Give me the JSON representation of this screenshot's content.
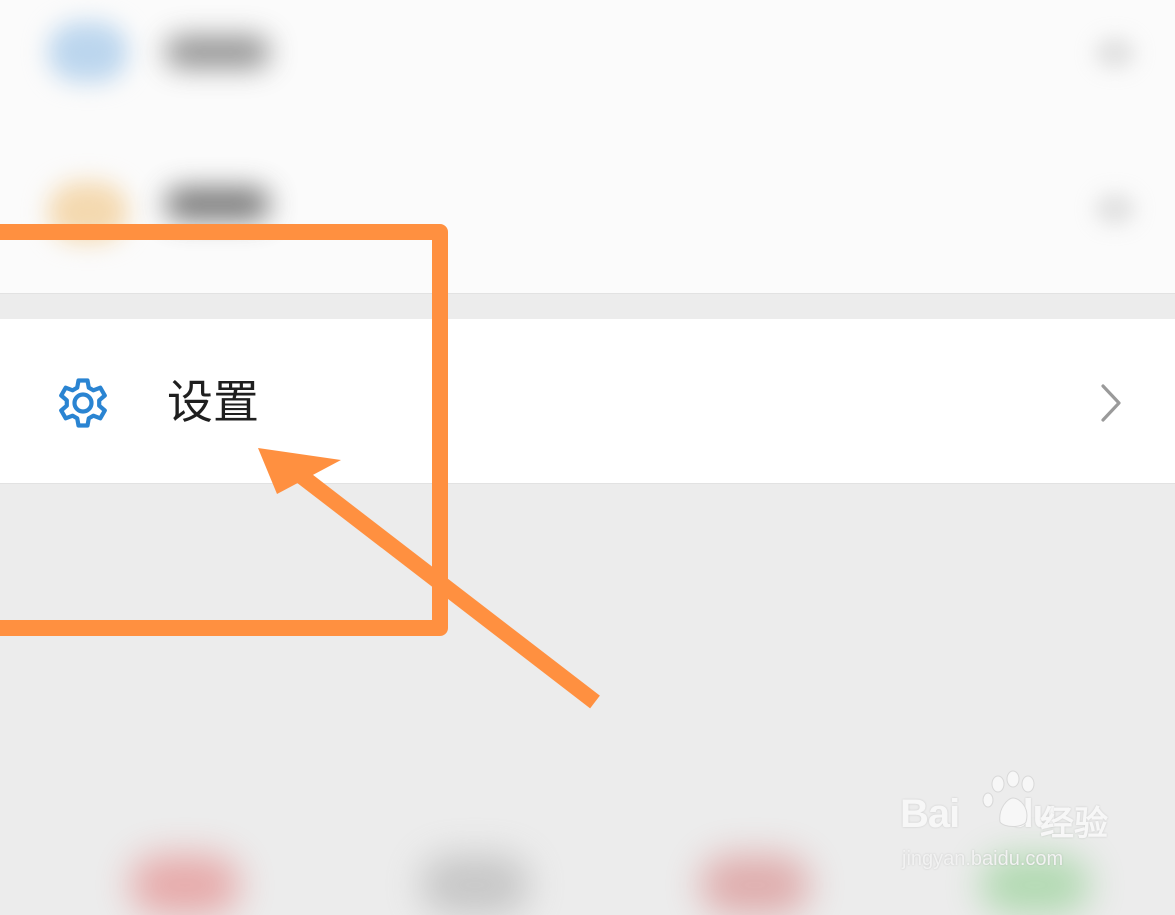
{
  "settings_item": {
    "label": "设置",
    "icon": "gear-icon",
    "icon_color": "#2a84d2",
    "chevron": "chevron-right-icon"
  },
  "annotation": {
    "color": "#ff9040",
    "shapes": [
      "highlight-box",
      "pointer-arrow"
    ]
  },
  "watermark": {
    "brand": "Bai",
    "brand_end": "du",
    "suffix": "经验",
    "url": "jingyan.baidu.com"
  },
  "colors": {
    "page_bg": "#ececec",
    "panel_bg": "#fbfbfb",
    "row_bg": "#ffffff",
    "text": "#1f1f1f"
  }
}
